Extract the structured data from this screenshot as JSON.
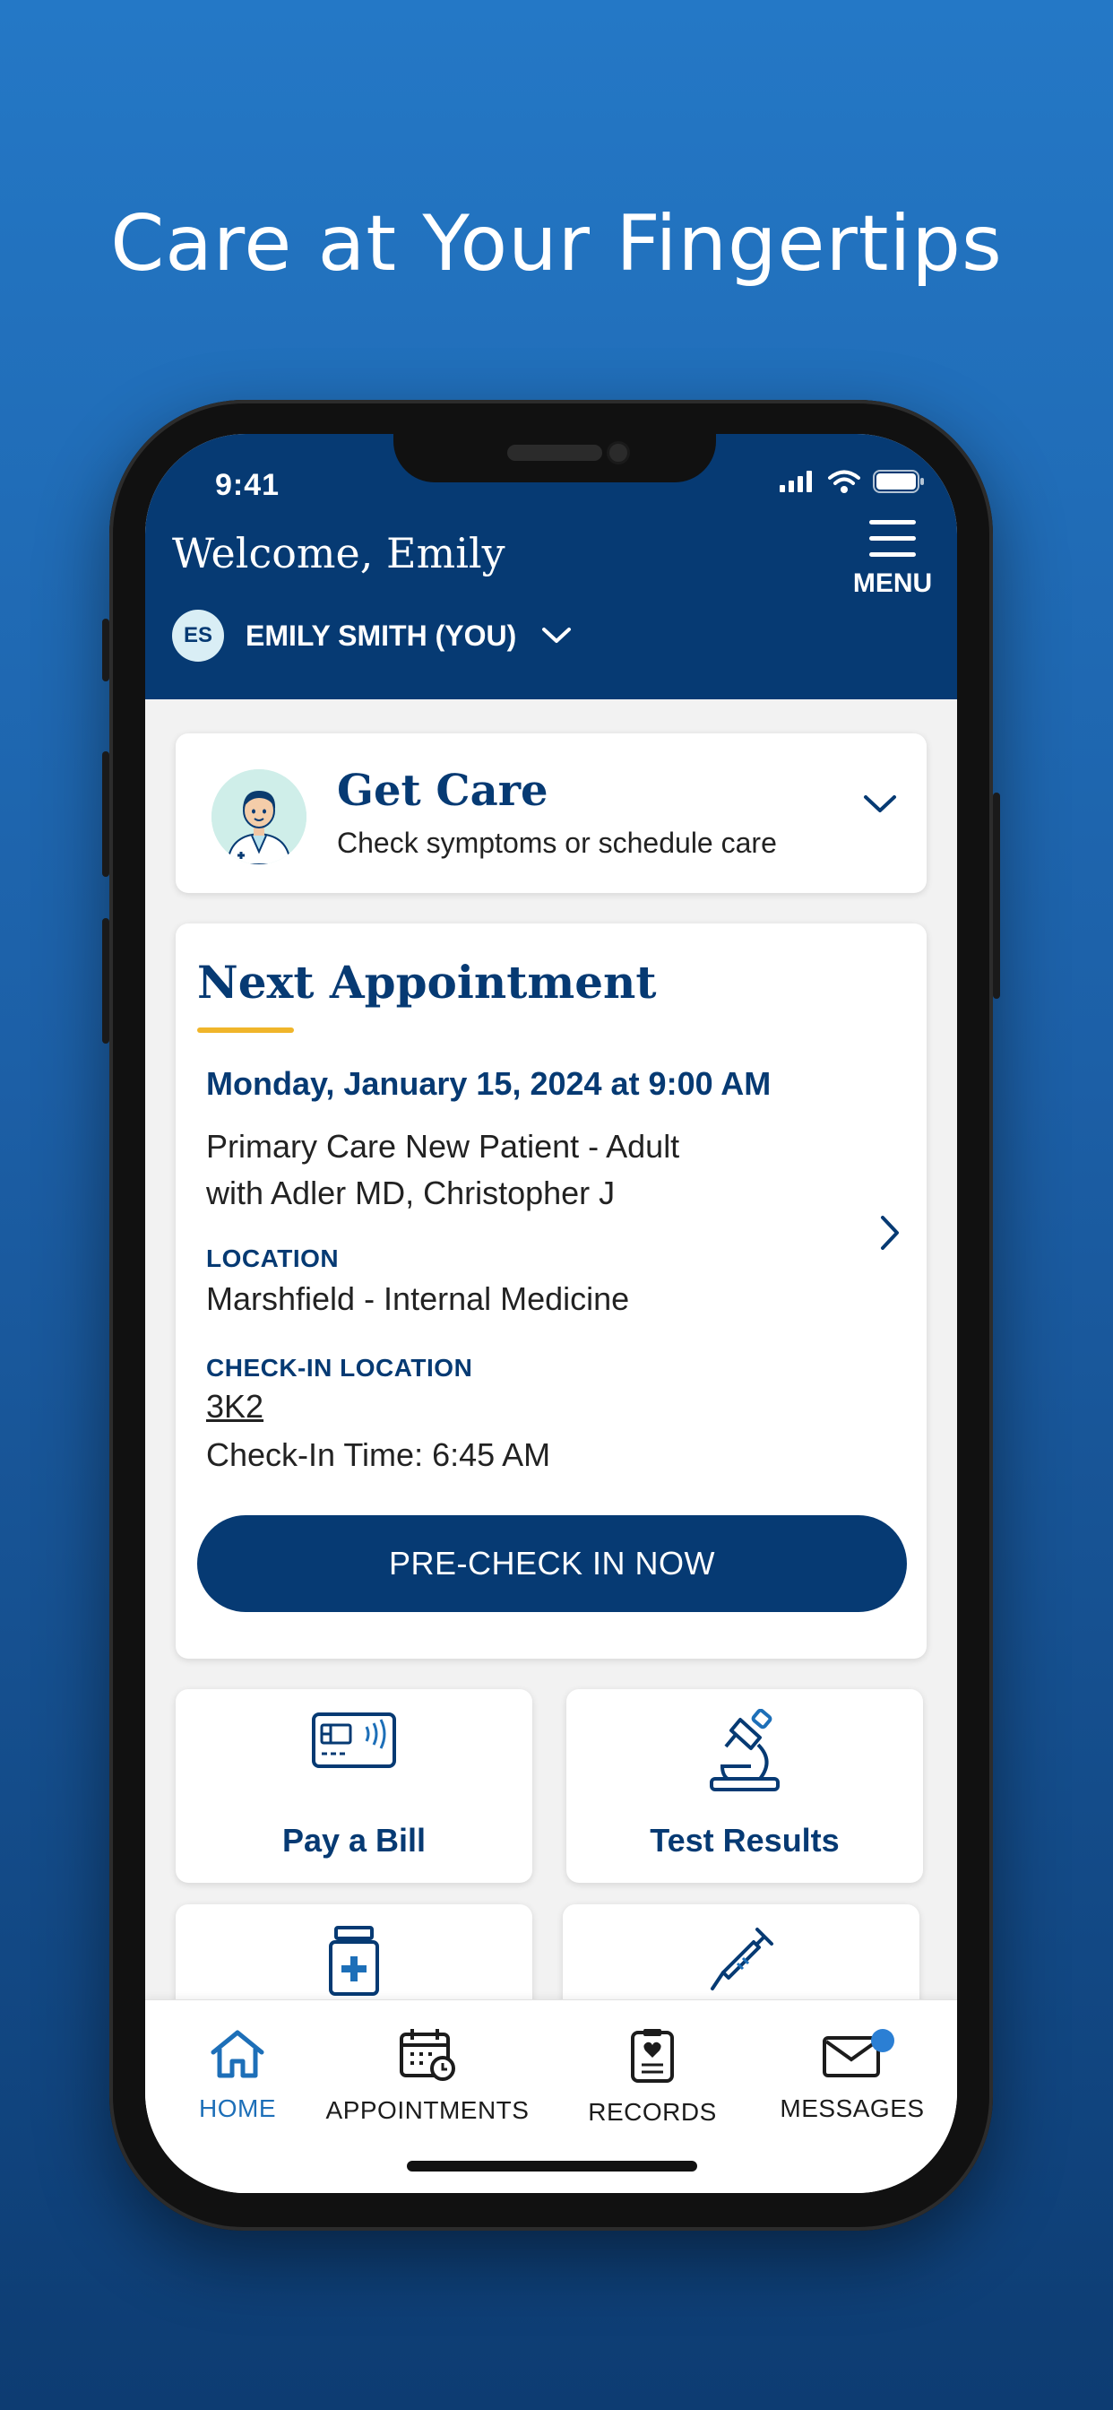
{
  "hero": {
    "title": "Care at Your Fingertips"
  },
  "status_bar": {
    "time": "9:41"
  },
  "header": {
    "welcome": "Welcome, Emily",
    "menu_label": "MENU",
    "user_initials": "ES",
    "user_name": "EMILY SMITH (YOU)"
  },
  "get_care": {
    "title": "Get Care",
    "subtitle": "Check symptoms or schedule care"
  },
  "next_appointment": {
    "title": "Next Appointment",
    "datetime": "Monday, January 15, 2024 at 9:00 AM",
    "visit_type": "Primary Care New Patient - Adult",
    "provider": "with Adler MD, Christopher J",
    "location_label": "LOCATION",
    "location": "Marshfield - Internal Medicine",
    "checkin_label": "CHECK-IN LOCATION",
    "checkin_location": "3K2",
    "checkin_time": "Check-In Time: 6:45 AM",
    "button": "PRE-CHECK IN NOW"
  },
  "tiles": [
    {
      "label": "Pay a Bill",
      "icon": "payment-card-icon"
    },
    {
      "label": "Test Results",
      "icon": "microscope-icon"
    },
    {
      "label": "",
      "icon": "medication-bottle-icon"
    },
    {
      "label": "",
      "icon": "syringe-icon"
    }
  ],
  "tabbar": [
    {
      "label": "HOME",
      "icon": "home-icon",
      "active": true
    },
    {
      "label": "APPOINTMENTS",
      "icon": "calendar-icon"
    },
    {
      "label": "RECORDS",
      "icon": "clipboard-icon"
    },
    {
      "label": "MESSAGES",
      "icon": "envelope-icon",
      "has_notification": true
    }
  ],
  "colors": {
    "brand_navy": "#063a73",
    "accent_gold": "#f0b52a",
    "active_tab": "#1d6fb8",
    "background_blue": "#2478c6"
  }
}
